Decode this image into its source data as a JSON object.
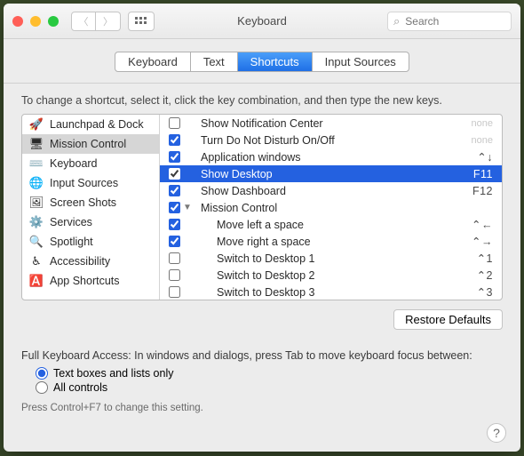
{
  "window": {
    "title": "Keyboard"
  },
  "search": {
    "placeholder": "Search"
  },
  "tabs": [
    {
      "label": "Keyboard",
      "active": false
    },
    {
      "label": "Text",
      "active": false
    },
    {
      "label": "Shortcuts",
      "active": true
    },
    {
      "label": "Input Sources",
      "active": false
    }
  ],
  "instruction": "To change a shortcut, select it, click the key combination, and then type the new keys.",
  "categories": [
    {
      "label": "Launchpad & Dock",
      "icon": "🚀",
      "selected": false
    },
    {
      "label": "Mission Control",
      "icon": "🖥",
      "selected": true
    },
    {
      "label": "Keyboard",
      "icon": "⌨️",
      "selected": false
    },
    {
      "label": "Input Sources",
      "icon": "🌐",
      "selected": false
    },
    {
      "label": "Screen Shots",
      "icon": "🖼",
      "selected": false
    },
    {
      "label": "Services",
      "icon": "⚙️",
      "selected": false
    },
    {
      "label": "Spotlight",
      "icon": "🔍",
      "selected": false
    },
    {
      "label": "Accessibility",
      "icon": "♿︎",
      "selected": false
    },
    {
      "label": "App Shortcuts",
      "icon": "🅰️",
      "selected": false
    }
  ],
  "shortcuts": [
    {
      "checked": false,
      "label": "Show Notification Center",
      "shortcut": "",
      "ghost": "none",
      "indent": 1,
      "highlighted": false,
      "disclosure": ""
    },
    {
      "checked": true,
      "label": "Turn Do Not Disturb On/Off",
      "shortcut": "",
      "ghost": "none",
      "indent": 1,
      "highlighted": false,
      "disclosure": ""
    },
    {
      "checked": true,
      "label": "Application windows",
      "shortcut": "⌃↓",
      "ghost": "",
      "indent": 1,
      "highlighted": false,
      "disclosure": ""
    },
    {
      "checked": true,
      "label": "Show Desktop",
      "shortcut": "F11",
      "ghost": "",
      "indent": 1,
      "highlighted": true,
      "disclosure": ""
    },
    {
      "checked": true,
      "label": "Show Dashboard",
      "shortcut": "F12",
      "ghost": "",
      "indent": 1,
      "highlighted": false,
      "disclosure": ""
    },
    {
      "checked": true,
      "label": "Mission Control",
      "shortcut": "",
      "ghost": "",
      "indent": 1,
      "highlighted": false,
      "disclosure": "▼"
    },
    {
      "checked": true,
      "label": "Move left a space",
      "shortcut": "⌃←",
      "ghost": "",
      "indent": 2,
      "highlighted": false,
      "disclosure": ""
    },
    {
      "checked": true,
      "label": "Move right a space",
      "shortcut": "⌃→",
      "ghost": "",
      "indent": 2,
      "highlighted": false,
      "disclosure": ""
    },
    {
      "checked": false,
      "label": "Switch to Desktop 1",
      "shortcut": "⌃1",
      "ghost": "",
      "indent": 2,
      "highlighted": false,
      "disclosure": ""
    },
    {
      "checked": false,
      "label": "Switch to Desktop 2",
      "shortcut": "⌃2",
      "ghost": "",
      "indent": 2,
      "highlighted": false,
      "disclosure": ""
    },
    {
      "checked": false,
      "label": "Switch to Desktop 3",
      "shortcut": "⌃3",
      "ghost": "",
      "indent": 2,
      "highlighted": false,
      "disclosure": ""
    }
  ],
  "restore_label": "Restore Defaults",
  "fka": {
    "label": "Full Keyboard Access: In windows and dialogs, press Tab to move keyboard focus between:",
    "options": [
      {
        "label": "Text boxes and lists only",
        "checked": true
      },
      {
        "label": "All controls",
        "checked": false
      }
    ],
    "hint": "Press Control+F7 to change this setting."
  }
}
